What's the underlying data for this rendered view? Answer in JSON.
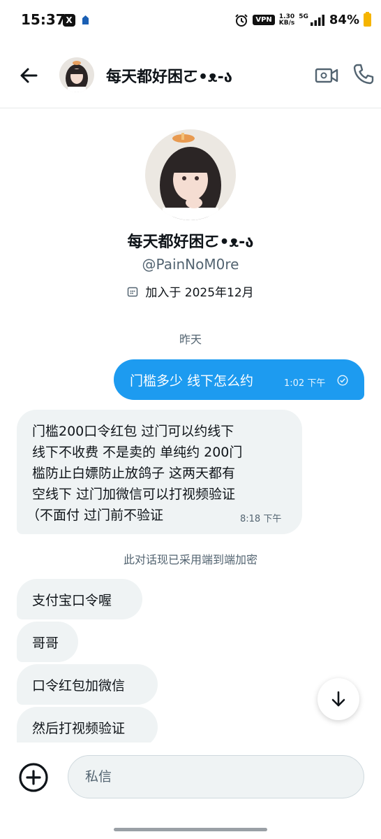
{
  "status_bar": {
    "time": "15:37",
    "vpn": "VPN",
    "speed_value": "1.30",
    "speed_unit": "KB/s",
    "network": "5G",
    "battery": "84%"
  },
  "header": {
    "title": "每天都好困ㄛ•ᴥ-ა",
    "back_icon": "arrow-left-icon",
    "video_icon": "video-camera-icon",
    "call_icon": "phone-icon"
  },
  "profile": {
    "name": "每天都好困ㄛ•ᴥ-ა",
    "handle": "@PainNoM0re",
    "joined": "加入于 2025年12月"
  },
  "conversation": {
    "date_separator": "昨天",
    "outgoing": {
      "text": "门槛多少 线下怎么约",
      "time": "1:02 下午"
    },
    "incoming_long": {
      "lines": [
        "门槛200口令红包 过门可以约线下",
        "线下不收费 不是卖的 单纯约 200门",
        "槛防止白嫖防止放鸽子 这两天都有",
        "空线下 过门加微信可以打视频验证",
        "（不面付 过门前不验证"
      ],
      "time": "8:18 下午"
    },
    "encryption_note": "此对话现已采用端到端加密",
    "incoming_short": [
      "支付宝口令喔",
      "哥哥",
      "口令红包加微信",
      "然后打视频验证"
    ]
  },
  "composer": {
    "placeholder": "私信"
  },
  "colors": {
    "accent": "#1d9bf0",
    "bubble_incoming": "#eff3f4",
    "secondary_text": "#536471"
  }
}
